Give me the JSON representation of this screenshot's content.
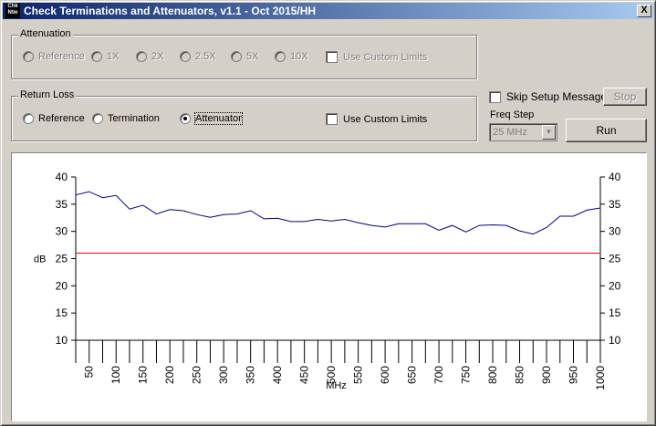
{
  "window": {
    "title": "Check Terminations and Attenuators, v1.1 - Oct 2015/HH",
    "icon_text_top": "Chk",
    "icon_text_bottom": "Ntw",
    "close_glyph": "X"
  },
  "attenuation": {
    "label": "Attenuation",
    "options": [
      "Reference",
      "1X",
      "2X",
      "2.5X",
      "5X",
      "10X"
    ],
    "custom_limits_label": "Use Custom Limits"
  },
  "return_loss": {
    "label": "Return Loss",
    "options": [
      "Reference",
      "Termination",
      "Attenuator"
    ],
    "selected": "Attenuator",
    "custom_limits_label": "Use Custom Limits"
  },
  "controls": {
    "skip_setup_label": "Skip Setup Message",
    "stop_label": "Stop",
    "freq_step_label": "Freq Step",
    "freq_step_value": "25 MHz",
    "run_label": "Run"
  },
  "chart_data": {
    "type": "line",
    "xlabel": "MHz",
    "ylabel": "dB",
    "x_ticks": [
      "50",
      "100",
      "150",
      "200",
      "250",
      "300",
      "350",
      "400",
      "450",
      "500",
      "550",
      "600",
      "650",
      "700",
      "750",
      "800",
      "850",
      "900",
      "950",
      "1000"
    ],
    "y_ticks": [
      "40",
      "35",
      "30",
      "25",
      "20",
      "15",
      "10"
    ],
    "ylim": [
      10,
      40
    ],
    "xlim": [
      25,
      1000
    ],
    "series": [
      {
        "color": "#00007f",
        "x": [
          25,
          50,
          75,
          100,
          125,
          150,
          175,
          200,
          225,
          250,
          275,
          300,
          325,
          350,
          375,
          400,
          425,
          450,
          475,
          500,
          525,
          550,
          575,
          600,
          625,
          650,
          675,
          700,
          725,
          750,
          775,
          800,
          825,
          850,
          875,
          900,
          925,
          950,
          975,
          1000
        ],
        "values": [
          36.7,
          37.3,
          36.2,
          36.6,
          34.1,
          34.8,
          33.2,
          34.0,
          33.8,
          33.1,
          32.6,
          33.1,
          33.2,
          33.8,
          32.3,
          32.4,
          31.8,
          31.8,
          32.2,
          31.9,
          32.2,
          31.6,
          31.1,
          30.8,
          31.4,
          31.4,
          31.4,
          30.2,
          31.1,
          29.9,
          31.1,
          31.2,
          31.1,
          30.1,
          29.5,
          30.7,
          32.8,
          32.8,
          33.9,
          34.3
        ]
      },
      {
        "color": "#ff0000",
        "x": [
          25,
          1000
        ],
        "values": [
          26,
          26
        ]
      }
    ],
    "grid": false,
    "legend": "none"
  }
}
